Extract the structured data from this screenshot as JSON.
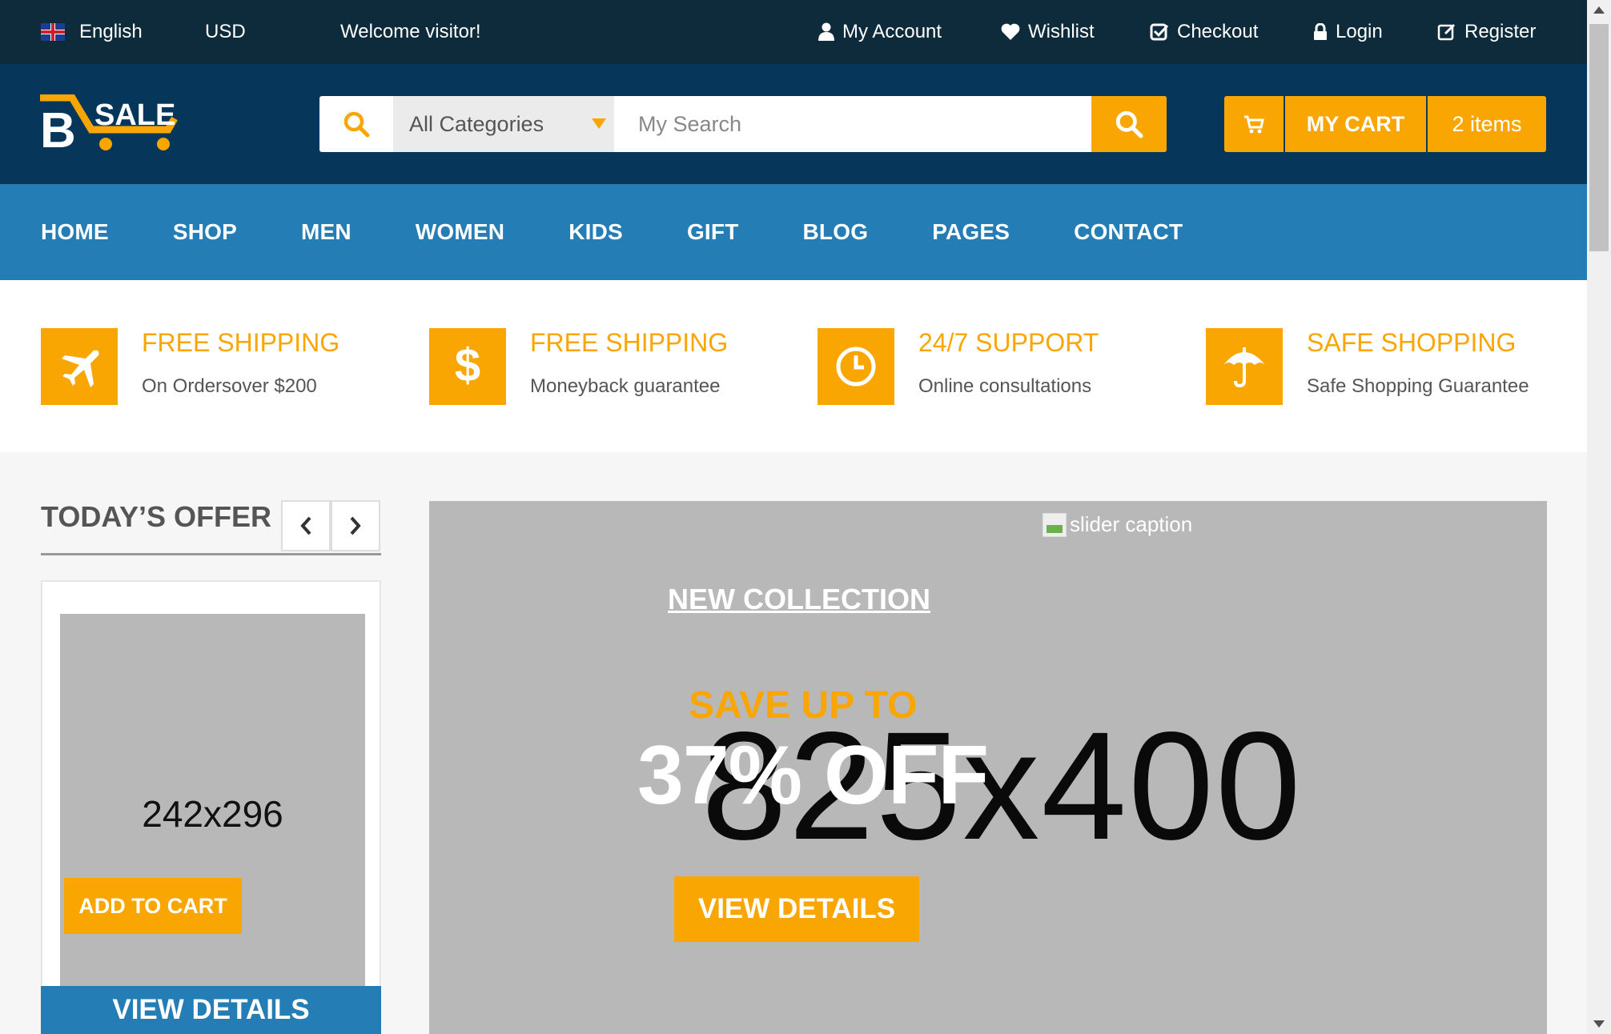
{
  "topbar": {
    "language": "English",
    "currency": "USD",
    "welcome": "Welcome visitor!",
    "links": {
      "account": "My Account",
      "wishlist": "Wishlist",
      "checkout": "Checkout",
      "login": "Login",
      "register": "Register"
    }
  },
  "logo": {
    "letter": "B",
    "text": "SALE"
  },
  "search": {
    "category": "All Categories",
    "placeholder": "My Search"
  },
  "cart": {
    "label": "MY CART",
    "count": "2 items"
  },
  "nav": [
    "HOME",
    "SHOP",
    "MEN",
    "WOMEN",
    "KIDS",
    "GIFT",
    "BLOG",
    "PAGES",
    "CONTACT"
  ],
  "features": [
    {
      "title": "FREE SHIPPING",
      "subtitle": "On Ordersover $200",
      "icon": "airplane-icon"
    },
    {
      "title": "FREE SHIPPING",
      "subtitle": "Moneyback guarantee",
      "icon": "dollar-icon"
    },
    {
      "title": "24/7 SUPPORT",
      "subtitle": "Online consultations",
      "icon": "clock-icon"
    },
    {
      "title": "SAFE SHOPPING",
      "subtitle": "Safe Shopping Guarantee",
      "icon": "umbrella-icon"
    }
  ],
  "offer": {
    "title": "TODAY’S OFFER",
    "image_text": "242x296",
    "add_to_cart": "ADD TO CART",
    "view_details": "VIEW DETAILS"
  },
  "slider": {
    "placeholder": "825x400",
    "caption_alt": "slider caption",
    "new_collection": "NEW COLLECTION",
    "save_up_to": "SAVE UP TO",
    "discount": "37% OFF",
    "view_details": "VIEW DETAILS"
  },
  "colors": {
    "accent": "#f9a602",
    "topbar": "#0d2b3b",
    "header": "#06375b",
    "nav": "#247db5"
  }
}
